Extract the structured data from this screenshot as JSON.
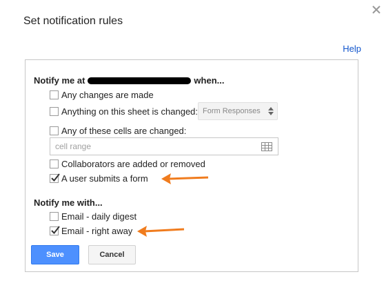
{
  "dialog": {
    "title": "Set notification rules",
    "help_link": "Help"
  },
  "notify_at": {
    "heading_prefix": "Notify me at",
    "heading_suffix": "when...",
    "options": [
      {
        "label": "Any changes are made",
        "checked": false
      },
      {
        "label": "Anything on this sheet is changed:",
        "checked": false
      },
      {
        "label": "Any of these cells are changed:",
        "checked": false
      },
      {
        "label": "Collaborators are added or removed",
        "checked": false
      },
      {
        "label": "A user submits a form",
        "checked": true
      }
    ],
    "sheet_select": {
      "value": "Form Responses"
    },
    "cell_range": {
      "value": "",
      "placeholder": "cell range"
    }
  },
  "notify_with": {
    "heading": "Notify me with...",
    "options": [
      {
        "label": "Email - daily digest",
        "checked": false
      },
      {
        "label": "Email - right away",
        "checked": true
      }
    ]
  },
  "buttons": {
    "save": "Save",
    "cancel": "Cancel"
  },
  "colors": {
    "primary_button": "#4d90fe",
    "link": "#1155cc",
    "annotation_arrow": "#f07c1e"
  },
  "icons": [
    "close-icon",
    "checkmark-icon",
    "select-arrows-icon",
    "grid-icon",
    "annotation-arrow"
  ]
}
